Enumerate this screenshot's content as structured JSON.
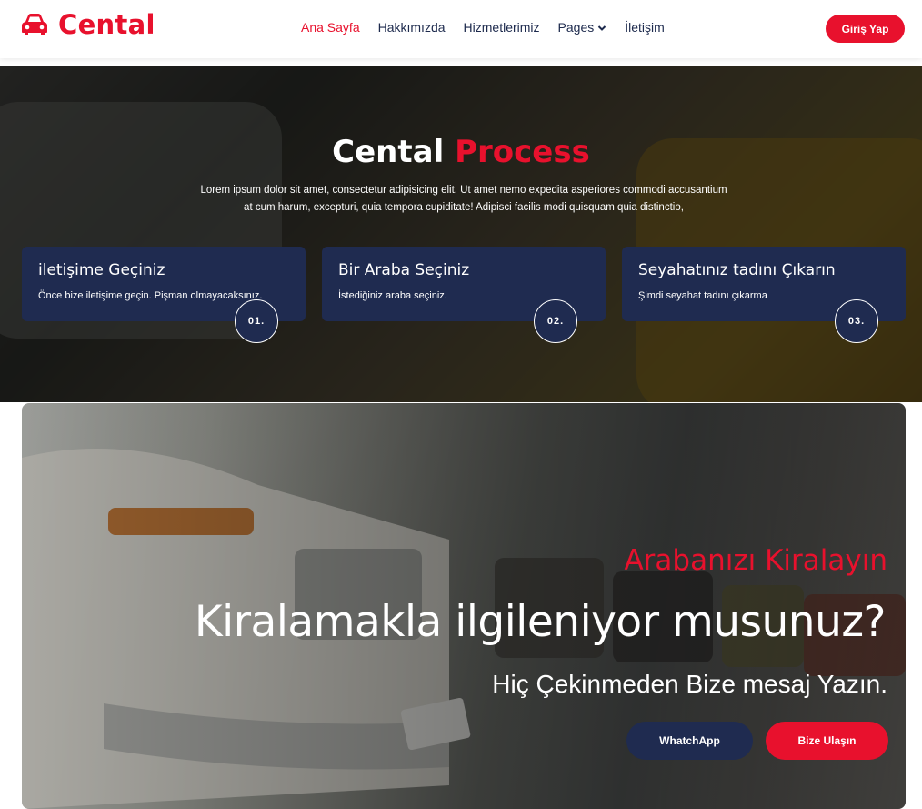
{
  "navbar": {
    "brand": "Cental",
    "brand_icon": "car-icon",
    "links": [
      "Ana Sayfa",
      "Hakkımızda",
      "Hizmetlerimiz",
      "Pages",
      "İletişim"
    ],
    "login_label": "Giriş Yap",
    "accent_color": "#e8112d"
  },
  "process": {
    "title_main": "Cental",
    "title_accent": "Process",
    "description_line1": "Lorem ipsum dolor sit amet, consectetur adipisicing elit. Ut amet nemo expedita asperiores commodi accusantium",
    "description_line2": "at cum harum, excepturi, quia tempora cupiditate! Adipisci facilis modi quisquam quia distinctio,",
    "steps": [
      {
        "title": "iletişime Geçiniz",
        "text": "Önce bize iletişime geçin. Pişman olmayacaksınız.",
        "number": "01."
      },
      {
        "title": "Bir Araba Seçiniz",
        "text": "İstediğiniz araba seçiniz.",
        "number": "02."
      },
      {
        "title": "Seyahatınız tadını Çıkarın",
        "text": "Şimdi seyahat tadını çıkarma",
        "number": "03."
      }
    ],
    "card_color": "#1f2b50"
  },
  "banner": {
    "subtitle": "Arabanızı Kiralayın",
    "title": "Kiralamakla ilgileniyor musunuz?",
    "text": "Hiç Çekinmeden Bize mesaj Yazın.",
    "whatsapp_label": "WhatchApp",
    "contact_label": "Bize Ulaşın"
  }
}
